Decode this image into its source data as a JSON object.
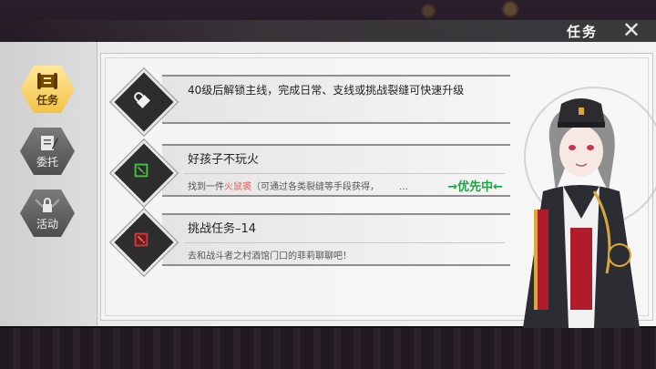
{
  "header": {
    "title": "任务",
    "close_label": "✕"
  },
  "tabs": [
    {
      "label": "任务",
      "icon": "scroll-icon",
      "active": true
    },
    {
      "label": "委托",
      "icon": "quill-paper-icon",
      "active": false
    },
    {
      "label": "活动",
      "icon": "chained-lock-icon",
      "active": false
    }
  ],
  "quests": [
    {
      "icon": "lock-icon",
      "title": "40级后解锁主线，完成日常、支线或挑战裂缝可快速升级"
    },
    {
      "icon": "exclamation-icon",
      "title": "好孩子不玩火",
      "desc_before": "找到一件",
      "desc_highlight": "火鼠裘",
      "desc_after": "（可通过各类裂缝等手段获得，",
      "ellipsis": "…",
      "priority_label": "→优先中←"
    },
    {
      "icon": "danger-icon",
      "title": "挑战任务–14",
      "desc": "去和战斗者之村酒馆门口的菲莉聊聊吧！"
    }
  ],
  "colors": {
    "accent_gold": "#f4c346",
    "priority_green": "#19a640",
    "highlight_red": "#e0615b"
  }
}
